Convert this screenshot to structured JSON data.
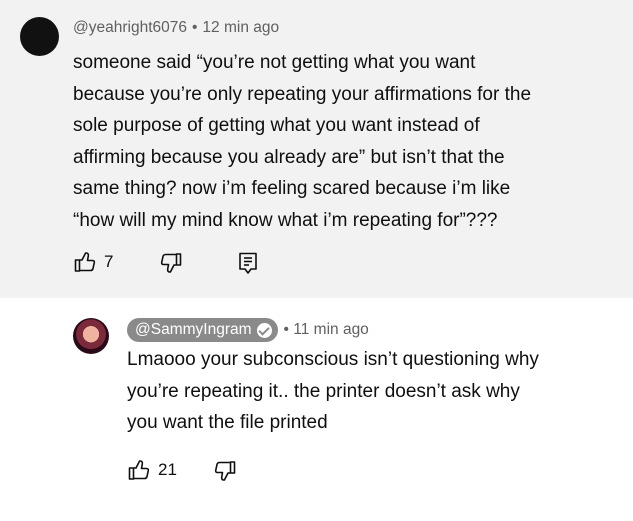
{
  "comment": {
    "handle": "@yeahright6076",
    "separator": "•",
    "time": "12 min ago",
    "lines": [
      "someone said “you’re not getting what you want",
      "because you’re only repeating your affirmations for the",
      "sole purpose of getting what you want instead of",
      "affirming because you already are” but isn’t that the",
      "same thing? now i’m feeling scared because i’m like",
      "“how will my mind know what i’m repeating for”???"
    ],
    "like_count": "7",
    "icons": [
      "thumbs-up-icon",
      "thumbs-down-icon",
      "reply-icon"
    ]
  },
  "reply": {
    "handle": "@SammyIngram",
    "separator": "•",
    "time": "11 min ago",
    "lines": [
      "Lmaooo your subconscious isn’t questioning why",
      "you’re repeating it.. the printer doesn’t ask why",
      "you want the file printed"
    ],
    "like_count": "21",
    "icons": [
      "verified-check-icon",
      "thumbs-up-icon",
      "thumbs-down-icon"
    ]
  },
  "colors": {
    "comment_background": "#f2f2f2",
    "muted_text": "#606060",
    "handle_pill": "#8a8a8a"
  }
}
